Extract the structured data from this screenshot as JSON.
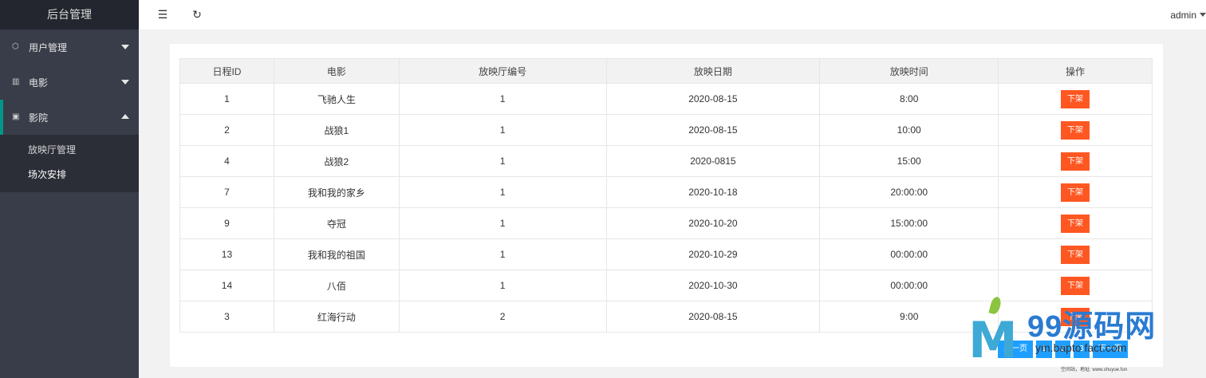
{
  "sidebar": {
    "title": "后台管理",
    "items": [
      {
        "label": "用户管理",
        "icon": "cube-icon"
      },
      {
        "label": "电影",
        "icon": "film-icon"
      },
      {
        "label": "影院",
        "icon": "apps-icon"
      }
    ],
    "subitems": [
      {
        "label": "放映厅管理"
      },
      {
        "label": "场次安排"
      }
    ]
  },
  "header": {
    "menu_icon": "☰",
    "refresh_icon": "↻",
    "user": "admin"
  },
  "table": {
    "columns": [
      "日程ID",
      "电影",
      "放映厅编号",
      "放映日期",
      "放映时间",
      "操作"
    ],
    "rows": [
      {
        "id": "1",
        "movie": "飞驰人生",
        "hall": "1",
        "date": "2020-08-15",
        "time": "8:00",
        "action": "下架"
      },
      {
        "id": "2",
        "movie": "战狼1",
        "hall": "1",
        "date": "2020-08-15",
        "time": "10:00",
        "action": "下架"
      },
      {
        "id": "4",
        "movie": "战狼2",
        "hall": "1",
        "date": "2020-0815",
        "time": "15:00",
        "action": "下架"
      },
      {
        "id": "7",
        "movie": "我和我的家乡",
        "hall": "1",
        "date": "2020-10-18",
        "time": "20:00:00",
        "action": "下架"
      },
      {
        "id": "9",
        "movie": "夺冠",
        "hall": "1",
        "date": "2020-10-20",
        "time": "15:00:00",
        "action": "下架"
      },
      {
        "id": "13",
        "movie": "我和我的祖国",
        "hall": "1",
        "date": "2020-10-29",
        "time": "00:00:00",
        "action": "下架"
      },
      {
        "id": "14",
        "movie": "八佰",
        "hall": "1",
        "date": "2020-10-30",
        "time": "00:00:00",
        "action": "下架"
      },
      {
        "id": "3",
        "movie": "红海行动",
        "hall": "2",
        "date": "2020-08-15",
        "time": "9:00",
        "action": "下架"
      }
    ]
  },
  "pagination": {
    "prev": "上一页",
    "pages": [
      "1",
      "2",
      "3"
    ],
    "next": "下一页"
  },
  "watermark": {
    "mark": "M",
    "brand": "99源码网",
    "url": "ym.bapto fact.com",
    "small": "空间站，地址: www.shuyue.fun"
  },
  "colors": {
    "sidebar_bg": "#393d49",
    "accent": "#009688",
    "danger": "#ff5722",
    "primary": "#1e9fff"
  }
}
